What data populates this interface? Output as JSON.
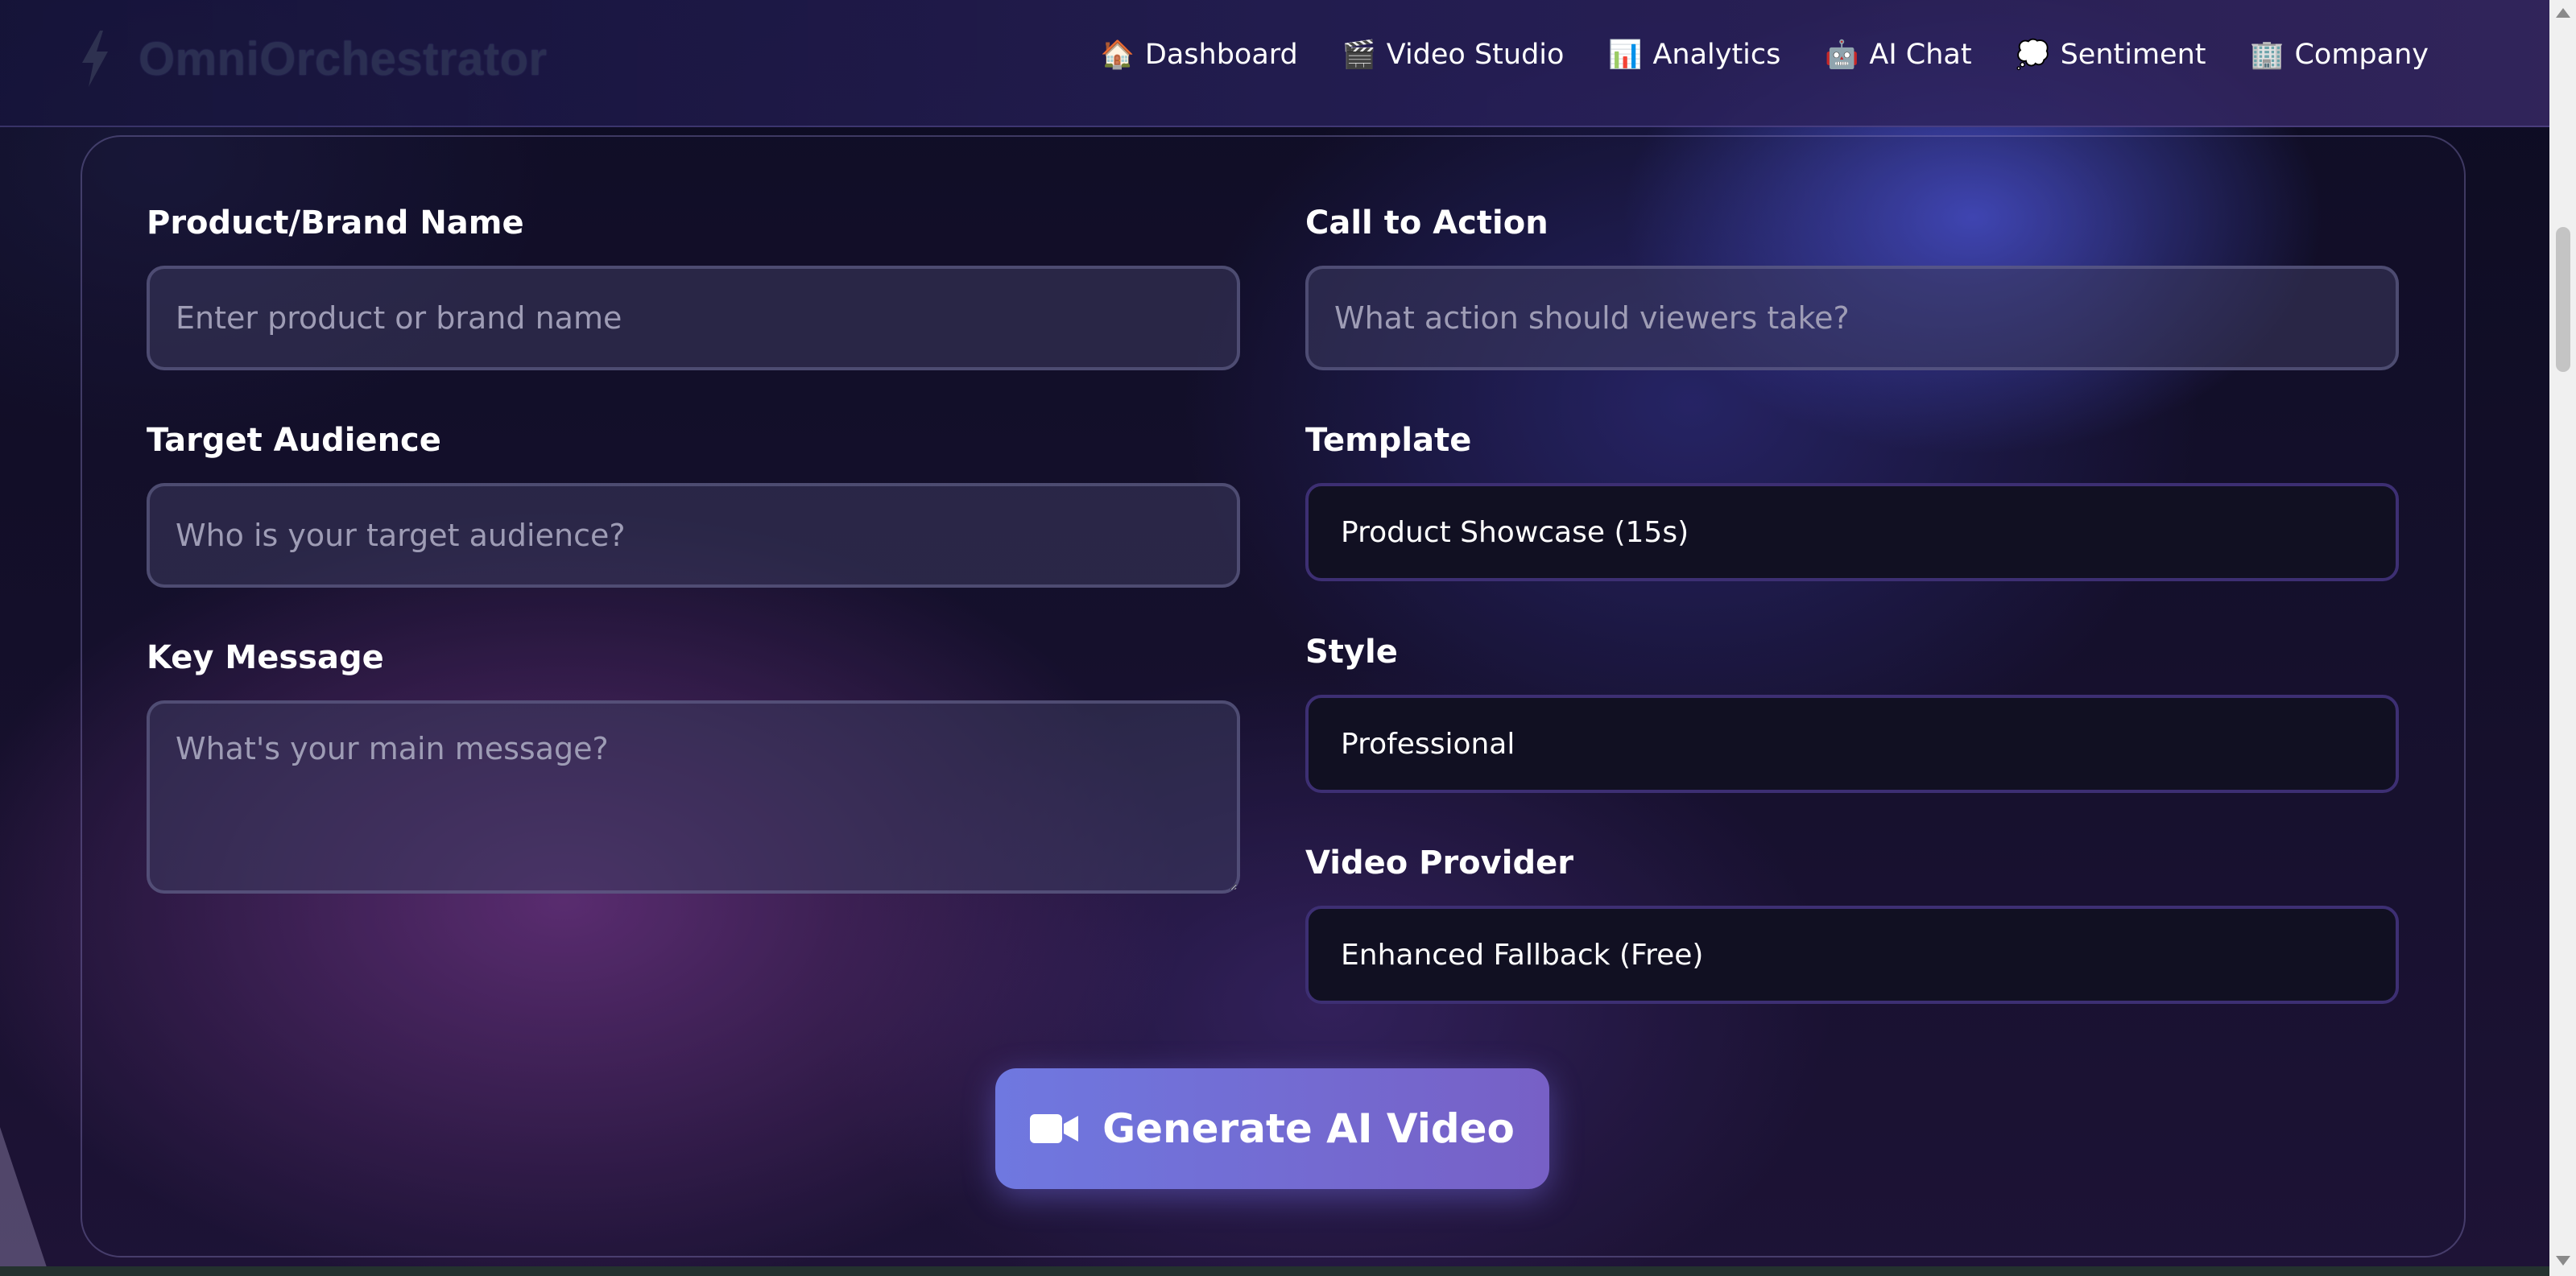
{
  "header": {
    "logo_text": "OmniOrchestrator",
    "logo_icon": "lightning-bolt-icon",
    "nav": [
      {
        "emoji": "🏠",
        "label": "Dashboard",
        "icon": "house-icon"
      },
      {
        "emoji": "🎬",
        "label": "Video Studio",
        "icon": "clapperboard-icon"
      },
      {
        "emoji": "📊",
        "label": "Analytics",
        "icon": "bar-chart-icon"
      },
      {
        "emoji": "🤖",
        "label": "AI Chat",
        "icon": "robot-icon"
      },
      {
        "emoji": "💭",
        "label": "Sentiment",
        "icon": "thought-bubble-icon"
      },
      {
        "emoji": "🏢",
        "label": "Company",
        "icon": "office-building-icon"
      }
    ]
  },
  "form": {
    "product": {
      "label": "Product/Brand Name",
      "placeholder": "Enter product or brand name",
      "value": ""
    },
    "audience": {
      "label": "Target Audience",
      "placeholder": "Who is your target audience?",
      "value": ""
    },
    "message": {
      "label": "Key Message",
      "placeholder": "What's your main message?",
      "value": ""
    },
    "cta": {
      "label": "Call to Action",
      "placeholder": "What action should viewers take?",
      "value": ""
    },
    "template": {
      "label": "Template",
      "selected": "Product Showcase (15s)"
    },
    "style": {
      "label": "Style",
      "selected": "Professional"
    },
    "provider": {
      "label": "Video Provider",
      "selected": "Enhanced Fallback (Free)"
    },
    "generate_label": "Generate AI Video",
    "generate_icon": "video-camera-icon"
  },
  "colors": {
    "accent_gradient_start": "#6f78e0",
    "accent_gradient_end": "#7760c6",
    "select_border": "#3d2f73",
    "logo_text": "#2b2f52"
  }
}
